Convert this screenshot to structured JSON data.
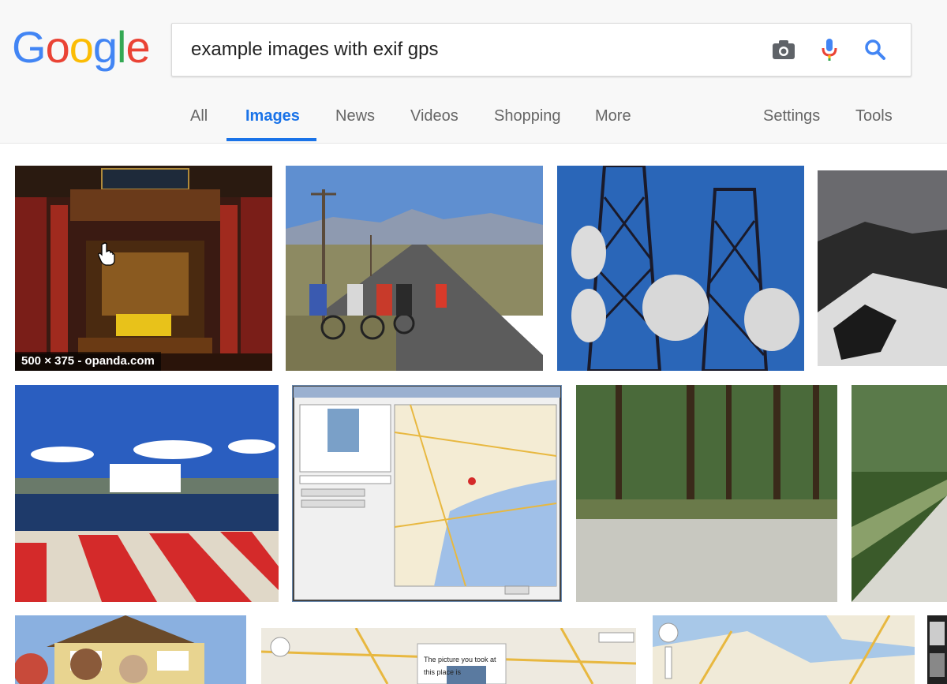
{
  "search": {
    "logo_text": "Google",
    "query": "example images with exif gps",
    "camera_icon": "camera-icon",
    "mic_icon": "microphone-icon",
    "search_icon": "search-icon"
  },
  "tabs": [
    {
      "label": "All"
    },
    {
      "label": "Images"
    },
    {
      "label": "News"
    },
    {
      "label": "Videos"
    },
    {
      "label": "Shopping"
    },
    {
      "label": "More"
    },
    {
      "label": "Settings"
    },
    {
      "label": "Tools"
    }
  ],
  "active_tab": "Images",
  "results": {
    "first_caption": "500 × 375 - opanda.com",
    "map_popup_text": "The picture you took at this place is"
  },
  "colors": {
    "accent": "#1a73e8",
    "logo_blue": "#4285f4",
    "logo_red": "#ea4335",
    "logo_yellow": "#fbbc05",
    "logo_green": "#34a853"
  }
}
